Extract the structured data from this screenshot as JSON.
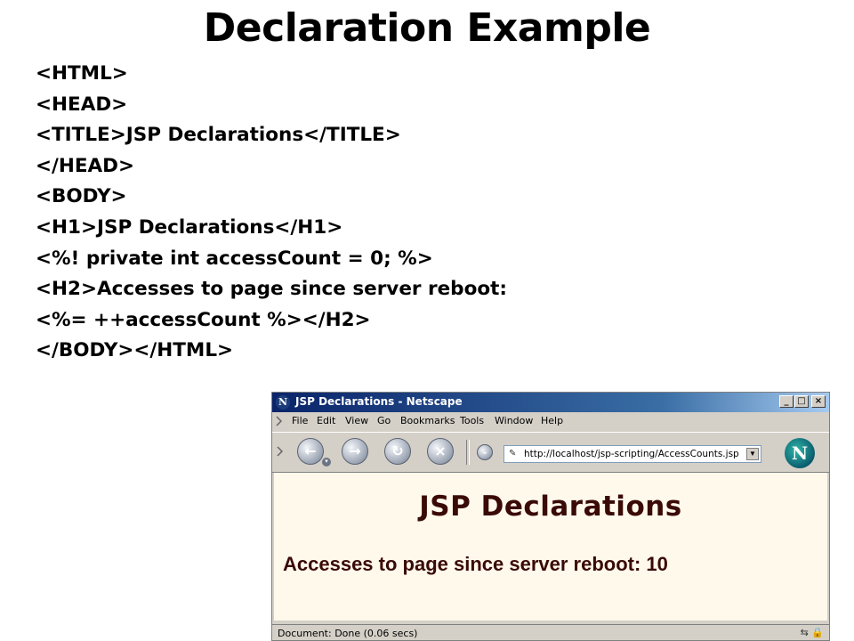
{
  "slide": {
    "title": "Declaration Example",
    "code_lines": [
      "<HTML>",
      "<HEAD>",
      "<TITLE>JSP Declarations</TITLE>",
      "</HEAD>",
      "<BODY>",
      "<H1>JSP Declarations</H1>",
      "<%! private int accessCount = 0; %>",
      "<H2>Accesses to page since server reboot:",
      "<%= ++accessCount %></H2>",
      "</BODY></HTML>"
    ]
  },
  "browser": {
    "window_title": "JSP Declarations - Netscape",
    "window_buttons": {
      "minimize": "_",
      "maximize": "□",
      "close": "×"
    },
    "menu": [
      "File",
      "Edit",
      "View",
      "Go",
      "Bookmarks",
      "Tools",
      "Window",
      "Help"
    ],
    "toolbar_icons": [
      "back-icon",
      "forward-icon",
      "reload-icon",
      "stop-icon",
      "search-icon"
    ],
    "url": "http://localhost/jsp-scripting/AccessCounts.jsp",
    "logo_letter": "N",
    "page": {
      "h1": "JSP Declarations",
      "h2": "Accesses to page since server reboot: 10"
    },
    "status": "Document: Done (0.06 secs)",
    "colors": {
      "page_background": "#fff9ec",
      "heading_color": "#3a0a06",
      "title_bar": "#0a246a"
    }
  }
}
